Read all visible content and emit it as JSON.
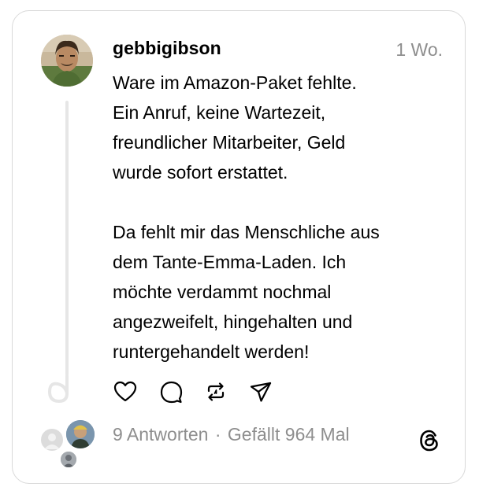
{
  "post": {
    "username": "gebbigibson",
    "time": "1 Wo.",
    "text": "Ware im Amazon-Paket fehlte.\nEin Anruf, keine Wartezeit,\nfreundlicher Mitarbeiter, Geld\nwurde sofort erstattet.\n\nDa fehlt mir das Menschliche aus\ndem Tante-Emma-Laden. Ich\nmöchte verdammt nochmal\nangezweifelt, hingehalten und\nruntergehandelt werden!"
  },
  "stats": {
    "replies": "9 Antworten",
    "separator": "·",
    "likes": "Gefällt 964 Mal"
  },
  "icons": {
    "like": "heart-icon",
    "comment": "comment-icon",
    "repost": "repost-icon",
    "share": "share-icon",
    "brand": "threads-logo-icon"
  },
  "colors": {
    "text": "#000000",
    "muted": "#8e8e8e",
    "border": "#d9d9d9"
  }
}
